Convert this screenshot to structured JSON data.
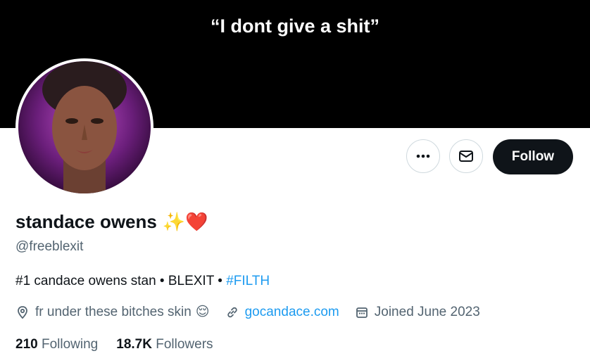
{
  "banner": {
    "text": "“I dont give a shit”"
  },
  "actions": {
    "more_icon": "more-horizontal-icon",
    "message_icon": "mail-icon",
    "follow_label": "Follow"
  },
  "profile": {
    "display_name": "standace owens",
    "name_emojis": "✨❤️",
    "handle": "@freeblexit",
    "bio_text": "#1 candace owens stan • BLEXIT • ",
    "bio_hashtag": "#FILTH",
    "location": "fr under these bitches skin",
    "location_emoji": "😌",
    "website": "gocandace.com",
    "joined": "Joined June 2023"
  },
  "stats": {
    "following_count": "210",
    "following_label": "Following",
    "followers_count": "18.7K",
    "followers_label": "Followers"
  },
  "colors": {
    "accent": "#1d9bf0",
    "text_primary": "#0f1419",
    "text_secondary": "#536471",
    "banner": "#000000"
  }
}
